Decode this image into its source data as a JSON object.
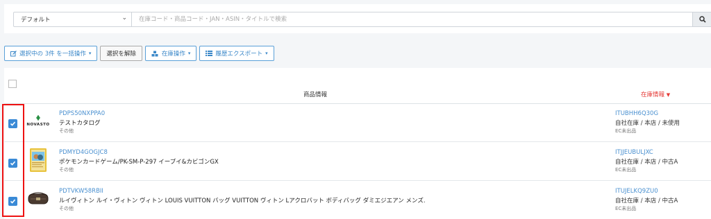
{
  "search": {
    "select_value": "デフォルト",
    "placeholder": "在庫コード・商品コード・JAN・ASIN・タイトルで検索"
  },
  "toolbar": {
    "bulk_label": "選択中の 3件 を一括操作",
    "deselect_label": "選択を解除",
    "stock_ops_label": "在庫操作",
    "history_export_label": "履歴エクスポート"
  },
  "table": {
    "col_product": "商品情報",
    "col_stock": "在庫情報"
  },
  "rows": [
    {
      "product_code": "PDPS50NXPPA0",
      "title": "テストカタログ",
      "category": "その他",
      "stock_code": "ITUBHH6Q30G",
      "location": "自社在庫 / 本店 / 未使用",
      "ec_status": "EC未出品",
      "thumb_text": "NOVASTO"
    },
    {
      "product_code": "PDMYD4GOGJC8",
      "title": "ポケモンカードゲーム/PK-SM-P-297 イーブイ&カビゴンGX",
      "category": "その他",
      "stock_code": "ITJJEUBULJXC",
      "location": "自社在庫 / 本店 / 中古A",
      "ec_status": "EC未出品",
      "thumb_text": ""
    },
    {
      "product_code": "PDTVKW58RBII",
      "title": "ルイヴィトン ルイ・ヴィトン ヴィトン LOUIS VUITTON バッグ VUITTON ヴィトン Lアクロバット ボディバッグ ダミエジエアン メンズ.",
      "category": "その他",
      "stock_code": "ITUJELKQ9ZU0",
      "location": "自社在庫 / 本店 / 中古A",
      "ec_status": "EC未出品",
      "thumb_text": ""
    }
  ],
  "colors": {
    "accent": "#3a87c8",
    "stock_header": "#e53935",
    "highlight_border": "#ee1111"
  }
}
